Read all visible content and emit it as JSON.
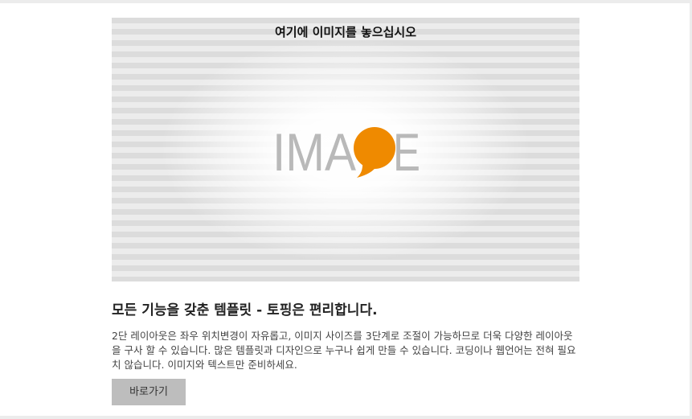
{
  "image": {
    "caption": "여기에 이미지를 놓으십시오",
    "logo_text_left": "IMA",
    "logo_text_right": "E",
    "accent_color": "#ef8a00"
  },
  "section": {
    "headline": "모든 기능을 갖춘 템플릿 - 토핑은 편리합니다.",
    "body": "2단 레이아웃은 좌우 위치변경이 자유롭고, 이미지 사이즈를 3단계로 조절이 가능하므로 더욱 다양한 레이아웃을 구사 할 수 있습니다. 많은 템플릿과 디자인으로 누구나 쉽게 만들 수 있습니다. 코딩이나 웹언어는 전혀 필요치 않습니다. 이미지와 텍스트만 준비하세요.",
    "button_label": "바로가기"
  }
}
